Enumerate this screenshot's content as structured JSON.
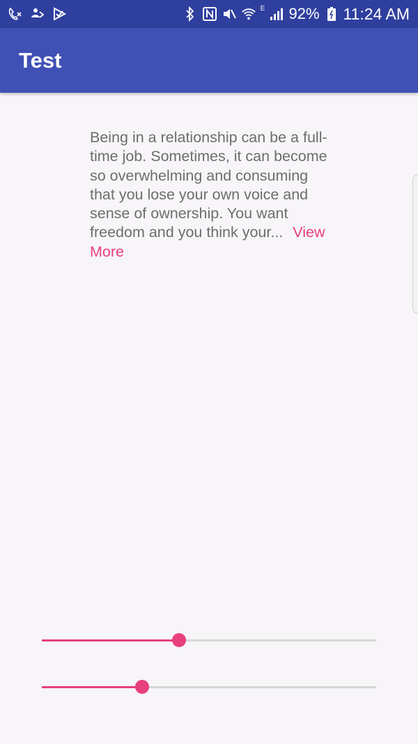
{
  "status_bar": {
    "battery": "92%",
    "time": "11:24 AM",
    "network_letter": "E",
    "left_icons": [
      "missed-call-icon",
      "share-icon",
      "play-store-icon"
    ],
    "right_icons": [
      "bluetooth-icon",
      "nfc-icon",
      "mute-icon",
      "wifi-icon",
      "signal-icon",
      "battery-icon"
    ]
  },
  "app_bar": {
    "title": "Test"
  },
  "content": {
    "text": "Being in a relationship can be a full-time job. Sometimes, it can become so overwhelming and consuming that you lose your own voice and sense of ownership. You want freedom and you think your...",
    "view_more": "View More"
  },
  "sliders": [
    {
      "name": "slider-1",
      "value": 0.41
    },
    {
      "name": "slider-2",
      "value": 0.3
    }
  ],
  "colors": {
    "status_bar": "#2f3f9e",
    "app_bar": "#3f51b5",
    "accent": "#e83f7d",
    "background": "#f7f5f8",
    "body_text": "#6d6d6d",
    "track": "#d6d6d6"
  }
}
